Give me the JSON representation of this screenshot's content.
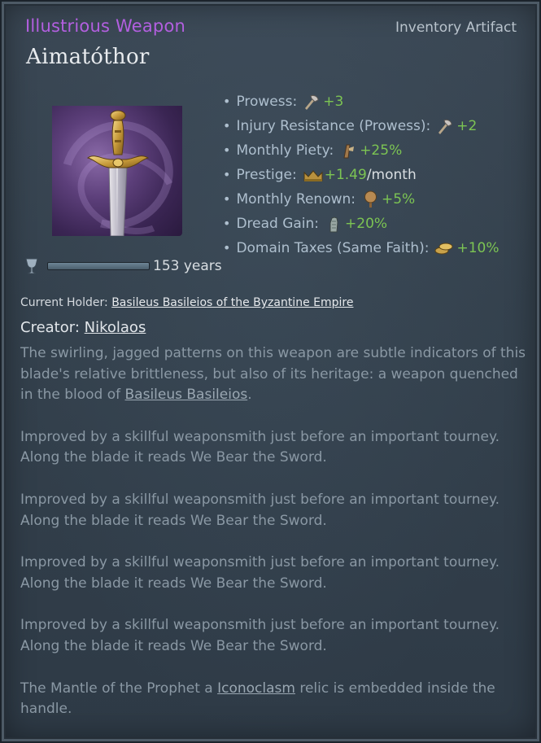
{
  "header": {
    "category": "Illustrious Weapon",
    "artifact_type": "Inventory Artifact",
    "title": "Aimatóthor"
  },
  "stats": [
    {
      "label": "Prowess:",
      "icon": "prowess-icon",
      "value": "+3",
      "unit": ""
    },
    {
      "label": "Injury Resistance (Prowess):",
      "icon": "prowess-icon",
      "value": "+2",
      "unit": ""
    },
    {
      "label": "Monthly Piety:",
      "icon": "piety-icon",
      "value": "+25%",
      "unit": ""
    },
    {
      "label": "Prestige:",
      "icon": "prestige-crown-icon",
      "value": "+1.49",
      "unit": "/month"
    },
    {
      "label": "Monthly Renown:",
      "icon": "renown-tree-icon",
      "value": "+5%",
      "unit": ""
    },
    {
      "label": "Dread Gain:",
      "icon": "dread-gauntlet-icon",
      "value": "+20%",
      "unit": ""
    },
    {
      "label": "Domain Taxes (Same Faith):",
      "icon": "gold-coins-icon",
      "value": "+10%",
      "unit": ""
    }
  ],
  "durability": {
    "icon": "goblet-icon",
    "fill": 1.0,
    "text": "153 years"
  },
  "holder": {
    "prefix": "Current Holder:",
    "name": "Basileus Basileios of the Byzantine Empire"
  },
  "creator": {
    "prefix": "Creator:",
    "name": "Nikolaos"
  },
  "description": {
    "p1_before": "The swirling, jagged patterns on this weapon are subtle indicators of this blade's relative brittleness, but also of its heritage: a weapon quenched in the blood of ",
    "p1_link": "Basileus Basileios",
    "p1_after": ".",
    "p2": "Improved by a skillful weaponsmith just before an important tourney. Along the blade it reads We Bear the Sword.",
    "p3": "Improved by a skillful weaponsmith just before an important tourney. Along the blade it reads We Bear the Sword.",
    "p4": "Improved by a skillful weaponsmith just before an important tourney. Along the blade it reads We Bear the Sword.",
    "p5": "Improved by a skillful weaponsmith just before an important tourney. Along the blade it reads We Bear the Sword.",
    "p6_before": "The Mantle of the Prophet a ",
    "p6_link": "Iconoclasm",
    "p6_after": " relic is embedded inside the handle."
  },
  "colors": {
    "category": "#b35fe0",
    "positive_value": "#7cc453",
    "description_text": "#8a98a4"
  }
}
